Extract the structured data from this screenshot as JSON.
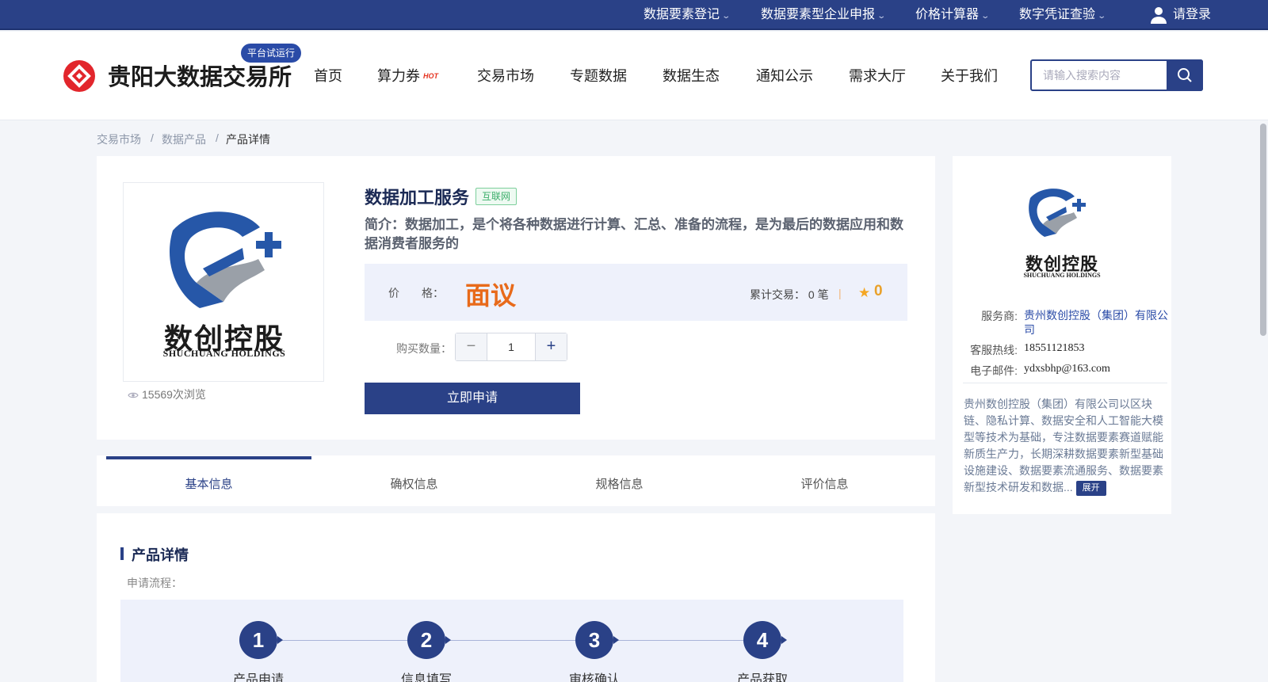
{
  "topbar": {
    "links": [
      {
        "label": "数据要素登记"
      },
      {
        "label": "数据要素型企业申报"
      },
      {
        "label": "价格计算器"
      },
      {
        "label": "数字凭证查验"
      }
    ],
    "login_label": "请登录",
    "chevron": "chevron-down-icon",
    "user_icon": "user-icon"
  },
  "header": {
    "brand": "贵阳大数据交易所",
    "trial_badge": "平台试运行",
    "nav": [
      "首页",
      "算力券",
      "交易市场",
      "专题数据",
      "数据生态",
      "通知公示",
      "需求大厅",
      "关于我们"
    ],
    "hot_badge": "HOT",
    "search": {
      "placeholder": "请输入搜索内容",
      "value": ""
    }
  },
  "breadcrumb": [
    "交易市场",
    "数据产品",
    "产品详情"
  ],
  "product": {
    "logo_text_cn": "数创控股",
    "logo_text_en": "SHUCHUANG HOLDINGS",
    "views": "15569次浏览",
    "title": "数据加工服务",
    "tag": "互联网",
    "desc": "简介：数据加工，是个将各种数据进行计算、汇总、准备的流程，是为最后的数据应用和数据消费者服务的",
    "price_label": "价　　格：",
    "price": "面议",
    "trade": "累计交易：  0 笔",
    "rating": "0",
    "qty_label": "购买数量：",
    "qty": "1",
    "qty_minus": "−",
    "qty_plus": "+",
    "apply": "立即申请"
  },
  "tabs": [
    {
      "label": "基本信息",
      "active": true
    },
    {
      "label": "确权信息",
      "active": false
    },
    {
      "label": "规格信息",
      "active": false
    },
    {
      "label": "评价信息",
      "active": false
    }
  ],
  "detail": {
    "title": "产品详情",
    "subtitle": "申请流程：",
    "steps": [
      {
        "num": "1",
        "label": "产品申请"
      },
      {
        "num": "2",
        "label": "信息填写"
      },
      {
        "num": "3",
        "label": "审核确认"
      },
      {
        "num": "4",
        "label": "产品获取"
      }
    ]
  },
  "provider": {
    "service_label": "服务商:",
    "service_value": "贵州数创控股（集团）有限公司",
    "phone_label": "客服热线:",
    "phone_value": "18551121853",
    "email_label": "电子邮件:",
    "email_value": "ydxsbhp@163.com",
    "desc": "贵州数创控股（集团）有限公司以区块链、隐私计算、数据安全和人工智能大模型等技术为基础，专注数据要素赛道赋能新质生产力，长期深耕数据要素新型基础设施建设、数据要素流通服务、数据要素新型技术研发和数据...",
    "expand": "展开"
  },
  "colors": {
    "primary": "#2a4187",
    "price": "#e86a1a",
    "star": "#f4a623",
    "tag_green": "#3bae6a"
  }
}
